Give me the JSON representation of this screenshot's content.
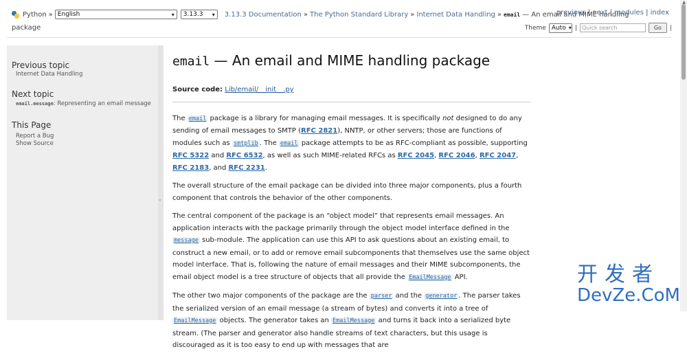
{
  "topbar": {
    "python_label": "Python",
    "language_select": "English",
    "version_select": "3.13.3",
    "breadcrumbs": [
      "3.13.3 Documentation",
      "The Python Standard Library",
      "Internet Data Handling"
    ],
    "current_code": "email",
    "current_rest": "— An email and MIME handling",
    "current_rest_line2": "package",
    "separator": "»",
    "related": [
      "previous",
      "next",
      "modules",
      "index"
    ],
    "theme_label": "Theme",
    "theme_value": "Auto",
    "search_placeholder": "Quick search",
    "go_label": "Go"
  },
  "sidebar": {
    "prev_heading": "Previous topic",
    "prev_link": "Internet Data Handling",
    "next_heading": "Next topic",
    "next_code": "email.message",
    "next_rest": ": Representing an email message",
    "page_heading": "This Page",
    "report_bug": "Report a Bug",
    "show_source": "Show Source"
  },
  "content": {
    "title_code": "email",
    "title_rest": " — An email and MIME handling package",
    "source_label": "Source code:",
    "source_link": "Lib/email/__init__.py",
    "p1": {
      "a": "The ",
      "email1": "email",
      "b": " package is a library for managing email messages. It is specifically ",
      "not": "not",
      "c": " designed to do any sending of email messages to SMTP (",
      "rfc2821": "RFC 2821",
      "d": "), NNTP, or other servers; those are functions of modules such as ",
      "smtplib": "smtplib",
      "e": ". The ",
      "email2": "email",
      "f": " package attempts to be as RFC-compliant as possible, supporting ",
      "rfc5322": "RFC 5322",
      "g": " and ",
      "rfc6532": "RFC 6532",
      "h": ", as well as such MIME-related RFCs as ",
      "rfc2045": "RFC 2045",
      "rfc2046": "RFC 2046",
      "rfc2047": "RFC 2047",
      "rfc2183": "RFC 2183",
      "comma": ", ",
      "and": ", and ",
      "rfc2231": "RFC 2231",
      "end": "."
    },
    "p2": "The overall structure of the email package can be divided into three major components, plus a fourth component that controls the behavior of the other components.",
    "p3": {
      "a": "The central component of the package is an “object model” that represents email messages. An application interacts with the package primarily through the object model interface defined in the ",
      "message": "message",
      "b": " sub-module. The application can use this API to ask questions about an existing email, to construct a new email, or to add or remove email subcomponents that themselves use the same object model interface. That is, following the nature of email messages and their MIME subcomponents, the email object model is a tree structure of objects that all provide the ",
      "emailmessage": "EmailMessage",
      "c": " API."
    },
    "p4": {
      "a": "The other two major components of the package are the ",
      "parser": "parser",
      "b": " and the ",
      "generator": "generator",
      "c": ". The parser takes the serialized version of an email message (a stream of bytes) and converts it into a tree of ",
      "em1": "EmailMessage",
      "d": " objects. The generator takes an ",
      "em2": "EmailMessage",
      "e": " and turns it back into a serialized byte stream. (The parser and generator also handle streams of text characters, but this usage is discouraged as it is too easy to end up with messages that are"
    }
  },
  "watermark": {
    "cn": "开发者",
    "en": "DevZe.CoM"
  }
}
